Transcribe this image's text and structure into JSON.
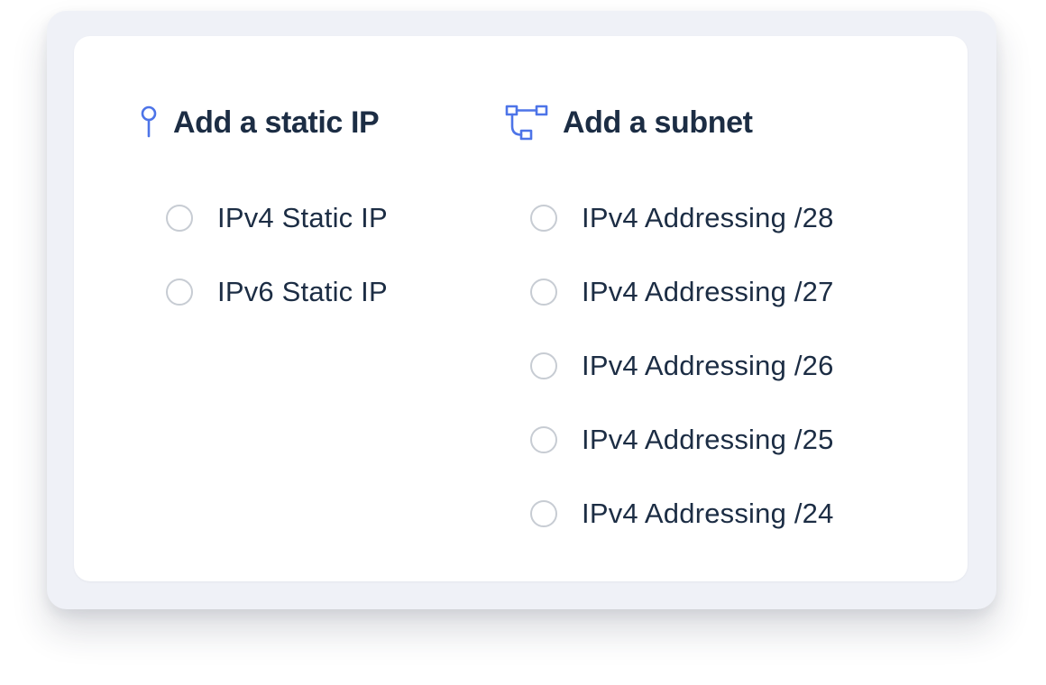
{
  "static_ip": {
    "title": "Add a static IP",
    "icon": "map-pin-icon",
    "options": [
      {
        "label": "IPv4 Static IP",
        "selected": false
      },
      {
        "label": "IPv6 Static IP",
        "selected": false
      }
    ]
  },
  "subnet": {
    "title": "Add a subnet",
    "icon": "network-topology-icon",
    "options": [
      {
        "label": "IPv4 Addressing /28",
        "selected": false
      },
      {
        "label": "IPv4 Addressing /27",
        "selected": false
      },
      {
        "label": "IPv4 Addressing /26",
        "selected": false
      },
      {
        "label": "IPv4 Addressing /25",
        "selected": false
      },
      {
        "label": "IPv4 Addressing /24",
        "selected": false
      }
    ]
  },
  "colors": {
    "accent_icon": "#4d74e8",
    "title_text": "#1c2d44",
    "radio_border": "#c7ccd3",
    "panel_bg": "#eff1f7",
    "card_bg": "#ffffff"
  }
}
